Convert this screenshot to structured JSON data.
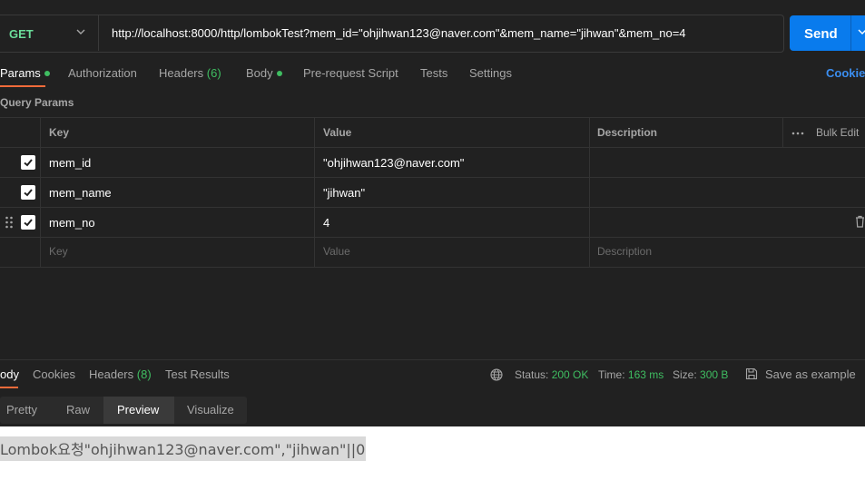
{
  "request": {
    "method": "GET",
    "url": "http://localhost:8000/http/lombokTest?mem_id=\"ohjihwan123@naver.com\"&mem_name=\"jihwan\"&mem_no=4",
    "send_label": "Send"
  },
  "tabs": {
    "params": "Params",
    "authorization": "Authorization",
    "headers": "Headers",
    "headers_count": "(6)",
    "body": "Body",
    "pre_request": "Pre-request Script",
    "tests": "Tests",
    "settings": "Settings",
    "cookies": "Cookies"
  },
  "query_params": {
    "title": "Query Params",
    "columns": {
      "key": "Key",
      "value": "Value",
      "description": "Description"
    },
    "bulk_edit": "Bulk Edit",
    "rows": [
      {
        "key": "mem_id",
        "value": "\"ohjihwan123@naver.com\"",
        "checked": true
      },
      {
        "key": "mem_name",
        "value": "\"jihwan\"",
        "checked": true
      },
      {
        "key": "mem_no",
        "value": "4",
        "checked": true
      }
    ],
    "placeholders": {
      "key": "Key",
      "value": "Value",
      "description": "Description"
    }
  },
  "response": {
    "tabs": {
      "body": "ody",
      "cookies": "Cookies",
      "headers": "Headers",
      "headers_count": "(8)",
      "test_results": "Test Results"
    },
    "status_label": "Status:",
    "status_value": "200 OK",
    "time_label": "Time:",
    "time_value": "163 ms",
    "size_label": "Size:",
    "size_value": "300 B",
    "save_example": "Save as example",
    "view_modes": {
      "pretty": "Pretty",
      "raw": "Raw",
      "preview": "Preview",
      "visualize": "Visualize"
    },
    "preview_text": "Lombok요청\"ohjihwan123@naver.com\",\"jihwan\"||0"
  },
  "colors": {
    "accent": "#f26b3a",
    "send": "#097bed",
    "green": "#3fbd61",
    "link": "#3b8ef0"
  }
}
